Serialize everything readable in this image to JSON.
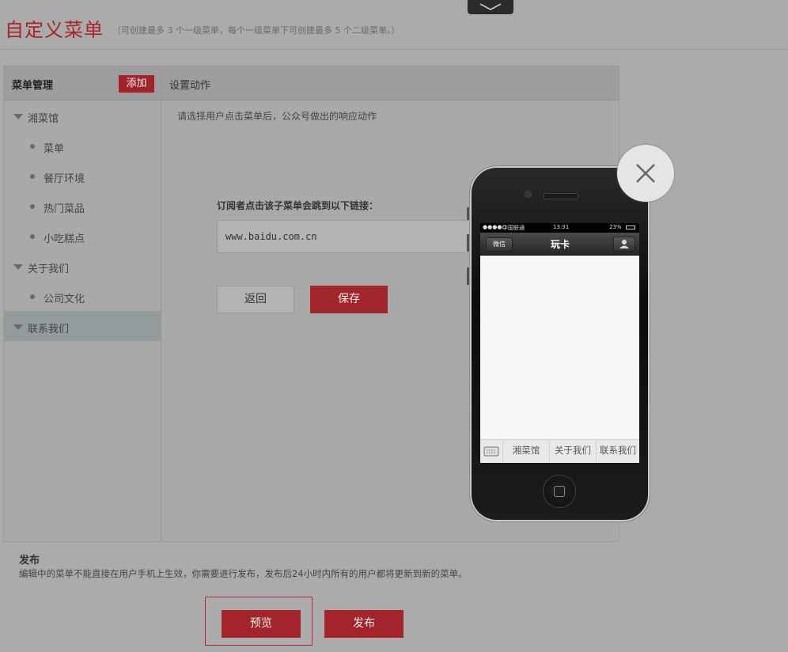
{
  "header": {
    "title": "自定义菜单",
    "subtitle": "（可创建最多 3 个一级菜单，每个一级菜单下可创建最多 5 个二级菜单。）"
  },
  "menu_panel": {
    "title": "菜单管理",
    "add_label": "添加",
    "items": [
      {
        "label": "湘菜馆",
        "level": 1
      },
      {
        "label": "菜单",
        "level": 2
      },
      {
        "label": "餐厅环境",
        "level": 2
      },
      {
        "label": "热门菜品",
        "level": 2
      },
      {
        "label": "小吃糕点",
        "level": 2
      },
      {
        "label": "关于我们",
        "level": 1
      },
      {
        "label": "公司文化",
        "level": 2
      },
      {
        "label": "联系我们",
        "level": 1,
        "selected": true
      }
    ]
  },
  "action_panel": {
    "title": "设置动作",
    "instruction": "请选择用户点击菜单后，公众号做出的响应动作",
    "link_label": "订阅者点击该子菜单会跳到以下链接：",
    "url_value": "www.baidu.com.cn",
    "back_label": "返回",
    "save_label": "保存"
  },
  "publish": {
    "title": "发布",
    "description": "编辑中的菜单不能直接在用户手机上生效，你需要进行发布，发布后24小时内所有的用户都将更新到新的菜单。",
    "preview_label": "预览",
    "publish_label": "发布"
  },
  "phone_preview": {
    "status": {
      "carrier": "中国联通",
      "time": "13:31",
      "battery": "23%"
    },
    "back_label": "微信",
    "title": "玩卡",
    "bottom_menu": [
      "湘菜馆",
      "关于我们",
      "联系我们"
    ]
  },
  "colors": {
    "accent_red": "#a4232b",
    "overlay_gray": "#ababab"
  }
}
